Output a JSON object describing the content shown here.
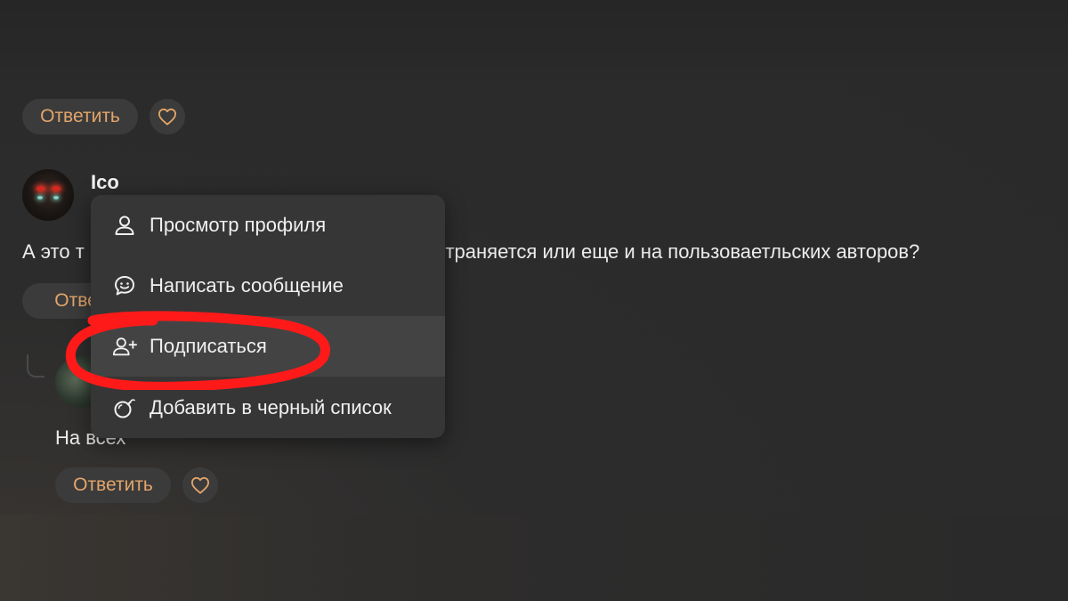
{
  "top_comment": {
    "reply_label": "Ответить"
  },
  "comment": {
    "author": "Ico",
    "text_visible_left": "А это т",
    "text_visible_right": "ространяется или еще и на пользоваетльских авторов?",
    "reply_label_partial": "Ответ"
  },
  "nested_comment": {
    "text_visible": "На всех",
    "reply_label": "Ответить"
  },
  "context_menu": {
    "items": [
      {
        "label": "Просмотр профиля",
        "icon": "user-icon"
      },
      {
        "label": "Написать сообщение",
        "icon": "chat-icon"
      },
      {
        "label": "Подписаться",
        "icon": "user-plus-icon",
        "highlighted": true
      },
      {
        "label": "Добавить в черный список",
        "icon": "bomb-icon"
      }
    ]
  },
  "colors": {
    "background": "#2a2a2a",
    "button_bg": "#3b3b3b",
    "accent": "#e3a56a",
    "menu_bg": "#363636",
    "menu_hover": "#434343",
    "annotation_red": "#ff1a1a"
  }
}
